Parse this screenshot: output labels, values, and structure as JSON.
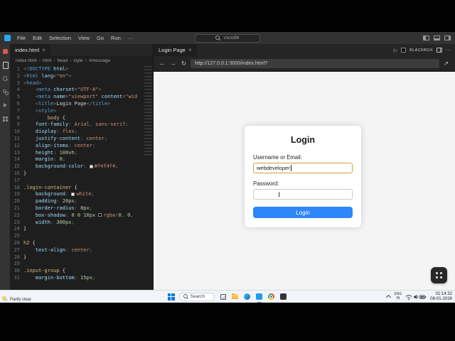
{
  "icons": {
    "close": "×",
    "chevron": "›",
    "back": "←",
    "forward": "→",
    "reload": "↻",
    "play": "▷",
    "more": "···",
    "external": "↗"
  },
  "titlebar": {
    "menus": [
      "File",
      "Edit",
      "Selection",
      "View",
      "Go",
      "Run",
      "···"
    ],
    "search_text": "vscode"
  },
  "editor": {
    "tab_label": "index.html",
    "breadcrumb": [
      "index.html",
      "html",
      "head",
      "style",
      "#message"
    ],
    "code_lines": [
      {
        "n": 1,
        "t": [
          [
            "p",
            "<"
          ],
          [
            "t",
            "!DOCTYPE"
          ],
          [
            "w",
            " "
          ],
          [
            "a",
            "html"
          ],
          [
            "p",
            ">"
          ]
        ]
      },
      {
        "n": 2,
        "t": [
          [
            "p",
            "<"
          ],
          [
            "t",
            "html"
          ],
          [
            "w",
            " "
          ],
          [
            "a",
            "lang"
          ],
          [
            "p",
            "="
          ],
          [
            "s",
            "\"en\""
          ],
          [
            "p",
            ">"
          ]
        ]
      },
      {
        "n": 3,
        "t": [
          [
            "p",
            "<"
          ],
          [
            "t",
            "head"
          ],
          [
            "p",
            ">"
          ]
        ]
      },
      {
        "n": 4,
        "t": [
          [
            "w",
            "    "
          ],
          [
            "p",
            "<"
          ],
          [
            "t",
            "meta"
          ],
          [
            "w",
            " "
          ],
          [
            "a",
            "charset"
          ],
          [
            "p",
            "="
          ],
          [
            "s",
            "\"UTF-8\""
          ],
          [
            "p",
            ">"
          ]
        ]
      },
      {
        "n": 5,
        "t": [
          [
            "w",
            "    "
          ],
          [
            "p",
            "<"
          ],
          [
            "t",
            "meta"
          ],
          [
            "w",
            " "
          ],
          [
            "a",
            "name"
          ],
          [
            "p",
            "="
          ],
          [
            "s",
            "\"viewport\""
          ],
          [
            "w",
            " "
          ],
          [
            "a",
            "content"
          ],
          [
            "p",
            "="
          ],
          [
            "s",
            "\"wid"
          ]
        ]
      },
      {
        "n": 6,
        "t": [
          [
            "w",
            "    "
          ],
          [
            "p",
            "<"
          ],
          [
            "t",
            "title"
          ],
          [
            "p",
            ">"
          ],
          [
            "w",
            "Login Page"
          ],
          [
            "p",
            "</"
          ],
          [
            "t",
            "title"
          ],
          [
            "p",
            ">"
          ]
        ]
      },
      {
        "n": 7,
        "t": [
          [
            "w",
            "    "
          ],
          [
            "p",
            "<"
          ],
          [
            "t",
            "style"
          ],
          [
            "p",
            ">"
          ]
        ]
      },
      {
        "n": 8,
        "t": [
          [
            "w",
            "        "
          ],
          [
            "sel",
            "body"
          ],
          [
            "w",
            " {"
          ]
        ]
      },
      {
        "n": 9,
        "t": [
          [
            "w",
            "    "
          ],
          [
            "prop",
            "font-family"
          ],
          [
            "p",
            ": "
          ],
          [
            "val",
            "Arial"
          ],
          [
            "p",
            ", "
          ],
          [
            "val",
            "sans-serif"
          ],
          [
            "p",
            ";"
          ]
        ]
      },
      {
        "n": 10,
        "t": [
          [
            "w",
            "    "
          ],
          [
            "prop",
            "display"
          ],
          [
            "p",
            ": "
          ],
          [
            "val",
            "flex"
          ],
          [
            "p",
            ";"
          ]
        ]
      },
      {
        "n": 11,
        "t": [
          [
            "w",
            "    "
          ],
          [
            "prop",
            "justify-content"
          ],
          [
            "p",
            ": "
          ],
          [
            "val",
            "center"
          ],
          [
            "p",
            ";"
          ]
        ]
      },
      {
        "n": 12,
        "t": [
          [
            "w",
            "    "
          ],
          [
            "prop",
            "align-items"
          ],
          [
            "p",
            ": "
          ],
          [
            "val",
            "center"
          ],
          [
            "p",
            ";"
          ]
        ]
      },
      {
        "n": 13,
        "t": [
          [
            "w",
            "    "
          ],
          [
            "prop",
            "height"
          ],
          [
            "p",
            ": "
          ],
          [
            "num",
            "100vh"
          ],
          [
            "p",
            ";"
          ]
        ]
      },
      {
        "n": 14,
        "t": [
          [
            "w",
            "    "
          ],
          [
            "prop",
            "margin"
          ],
          [
            "p",
            ": "
          ],
          [
            "num",
            "0"
          ],
          [
            "p",
            ";"
          ]
        ]
      },
      {
        "n": 15,
        "t": [
          [
            "w",
            "    "
          ],
          [
            "prop",
            "background-color"
          ],
          [
            "p",
            ": "
          ],
          [
            "sw",
            "#f4f4f4"
          ],
          [
            "val",
            "#f4f4f4"
          ],
          [
            "p",
            ";"
          ]
        ]
      },
      {
        "n": 16,
        "t": [
          [
            "w",
            "}"
          ]
        ]
      },
      {
        "n": 17,
        "t": []
      },
      {
        "n": 18,
        "t": [
          [
            "sel",
            ".login-container"
          ],
          [
            "w",
            " {"
          ]
        ]
      },
      {
        "n": 19,
        "t": [
          [
            "w",
            "    "
          ],
          [
            "prop",
            "background"
          ],
          [
            "p",
            ": "
          ],
          [
            "sw",
            "#ffffff"
          ],
          [
            "val",
            "white"
          ],
          [
            "p",
            ";"
          ]
        ]
      },
      {
        "n": 20,
        "t": [
          [
            "w",
            "    "
          ],
          [
            "prop",
            "padding"
          ],
          [
            "p",
            ": "
          ],
          [
            "num",
            "20px"
          ],
          [
            "p",
            ";"
          ]
        ]
      },
      {
        "n": 21,
        "t": [
          [
            "w",
            "    "
          ],
          [
            "prop",
            "border-radius"
          ],
          [
            "p",
            ": "
          ],
          [
            "num",
            "8px"
          ],
          [
            "p",
            ";"
          ]
        ]
      },
      {
        "n": 22,
        "t": [
          [
            "w",
            "    "
          ],
          [
            "prop",
            "box-shadow"
          ],
          [
            "p",
            ": "
          ],
          [
            "num",
            "0"
          ],
          [
            "w",
            " "
          ],
          [
            "num",
            "0"
          ],
          [
            "w",
            " "
          ],
          [
            "num",
            "10px"
          ],
          [
            "w",
            " "
          ],
          [
            "sw",
            "#000000"
          ],
          [
            "val",
            "rgba"
          ],
          [
            "p",
            "("
          ],
          [
            "num",
            "0"
          ],
          [
            "p",
            ", "
          ],
          [
            "num",
            "0"
          ],
          [
            "p",
            ","
          ]
        ]
      },
      {
        "n": 23,
        "t": [
          [
            "w",
            "    "
          ],
          [
            "prop",
            "width"
          ],
          [
            "p",
            ": "
          ],
          [
            "num",
            "300px"
          ],
          [
            "p",
            ";"
          ]
        ]
      },
      {
        "n": 24,
        "t": [
          [
            "w",
            "}"
          ]
        ]
      },
      {
        "n": 25,
        "t": []
      },
      {
        "n": 26,
        "t": [
          [
            "sel",
            "h2"
          ],
          [
            "w",
            " {"
          ]
        ]
      },
      {
        "n": 27,
        "t": [
          [
            "w",
            "    "
          ],
          [
            "prop",
            "text-align"
          ],
          [
            "p",
            ": "
          ],
          [
            "val",
            "center"
          ],
          [
            "p",
            ";"
          ]
        ]
      },
      {
        "n": 28,
        "t": [
          [
            "w",
            "}"
          ]
        ]
      },
      {
        "n": 29,
        "t": []
      },
      {
        "n": 30,
        "t": [
          [
            "sel",
            ".input-group"
          ],
          [
            "w",
            " {"
          ]
        ]
      },
      {
        "n": 31,
        "t": [
          [
            "w",
            "    "
          ],
          [
            "prop",
            "margin-bottom"
          ],
          [
            "p",
            ": "
          ],
          [
            "num",
            "15px"
          ],
          [
            "p",
            ";"
          ]
        ]
      }
    ]
  },
  "browser": {
    "tab_label": "Login Page",
    "extension_label": "BLACKBOX",
    "url": "http://127.0.0.1:3000/index.html?",
    "page": {
      "title": "Login",
      "username_label": "Username or Email:",
      "username_value": "webdeveloper",
      "password_label": "Password:",
      "button_label": "Login",
      "accent_color": "#2e86f7",
      "focus_border_color": "#d79b3a",
      "background_color": "#f4f4f4"
    }
  },
  "taskbar": {
    "weather_condition": "Partly clear",
    "search_label": "Search",
    "apps": [
      {
        "name": "task-view"
      },
      {
        "name": "file-explorer"
      },
      {
        "name": "edge"
      },
      {
        "name": "vscode",
        "active": true
      },
      {
        "name": "chrome"
      },
      {
        "name": "terminal"
      }
    ],
    "tray": {
      "lang_top": "ENG",
      "lang_bottom": "IN",
      "time": "01:14:32",
      "date": "08-01-2026"
    }
  }
}
